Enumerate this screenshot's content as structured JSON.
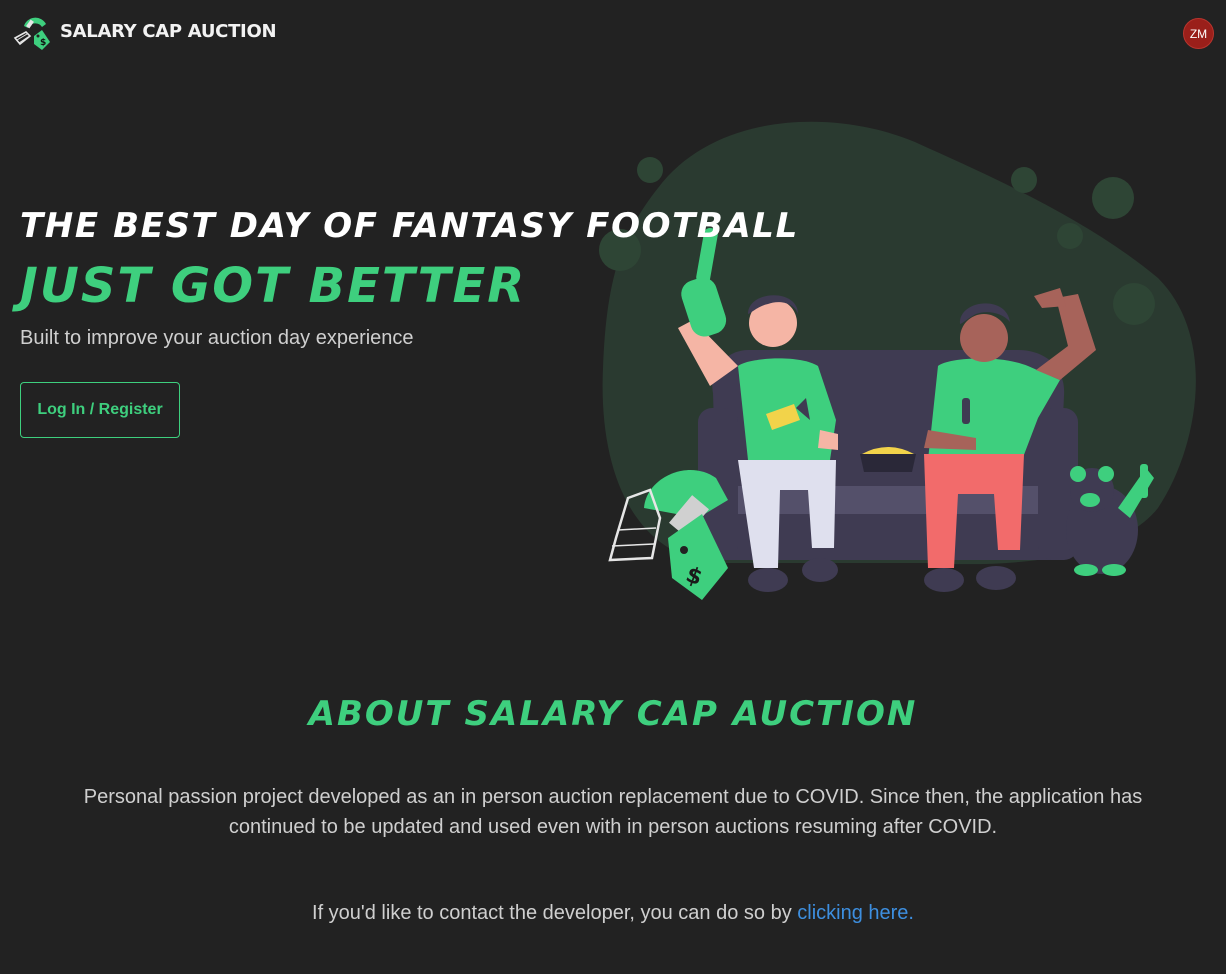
{
  "header": {
    "brand": "SALARY CAP AUCTION",
    "logo_icon": "helmet-price-tag-logo",
    "avatar_initials": "ZM"
  },
  "hero": {
    "headline_line1": "THE BEST DAY OF FANTASY FOOTBALL",
    "headline_line2": "JUST GOT BETTER",
    "subtitle": "Built to improve your auction day experience",
    "cta_label": "Log In / Register",
    "illustration": "fans-cheering-on-couch"
  },
  "about": {
    "title": "ABOUT SALARY CAP AUCTION",
    "description": "Personal passion project developed as an in person auction replacement due to COVID. Since then, the application has continued to be updated and used even with in person auctions resuming after COVID.",
    "contact_prefix": "If you'd like to contact the developer, you can do so by ",
    "contact_link": "clicking here."
  },
  "colors": {
    "background": "#222222",
    "accent": "#3ecf7e",
    "link": "#3d8fe0",
    "avatar": "#9a1f1a"
  }
}
